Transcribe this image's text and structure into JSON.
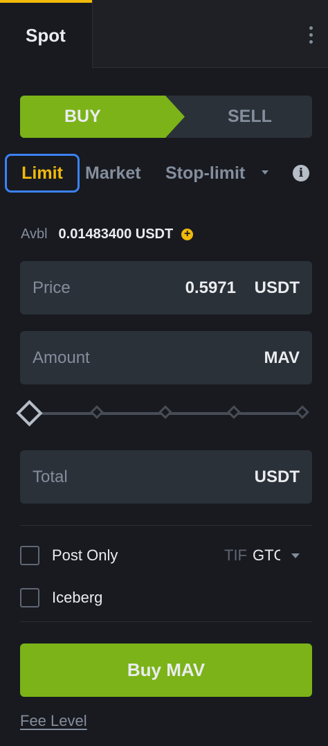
{
  "tabs": {
    "active": "Spot"
  },
  "side": {
    "buy_label": "BUY",
    "sell_label": "SELL"
  },
  "order_types": {
    "limit": "Limit",
    "market": "Market",
    "stop_limit": "Stop-limit"
  },
  "balance": {
    "label": "Avbl",
    "value": "0.01483400 USDT"
  },
  "price": {
    "label": "Price",
    "value": "0.5971",
    "unit": "USDT"
  },
  "amount": {
    "label": "Amount",
    "value": "",
    "unit": "MAV"
  },
  "slider": {
    "percent": 0,
    "steps": [
      0,
      25,
      50,
      75,
      100
    ]
  },
  "total": {
    "label": "Total",
    "value": "",
    "unit": "USDT"
  },
  "options": {
    "post_only_label": "Post Only",
    "iceberg_label": "Iceberg",
    "tif_label": "TIF",
    "tif_value": "GTC"
  },
  "buy_button_label": "Buy MAV",
  "fee_level_label": "Fee Level",
  "colors": {
    "buy": "#7bb318",
    "accent": "#f0b90b",
    "focus": "#3b82f6",
    "background": "#181a20",
    "input": "#2b3139"
  }
}
